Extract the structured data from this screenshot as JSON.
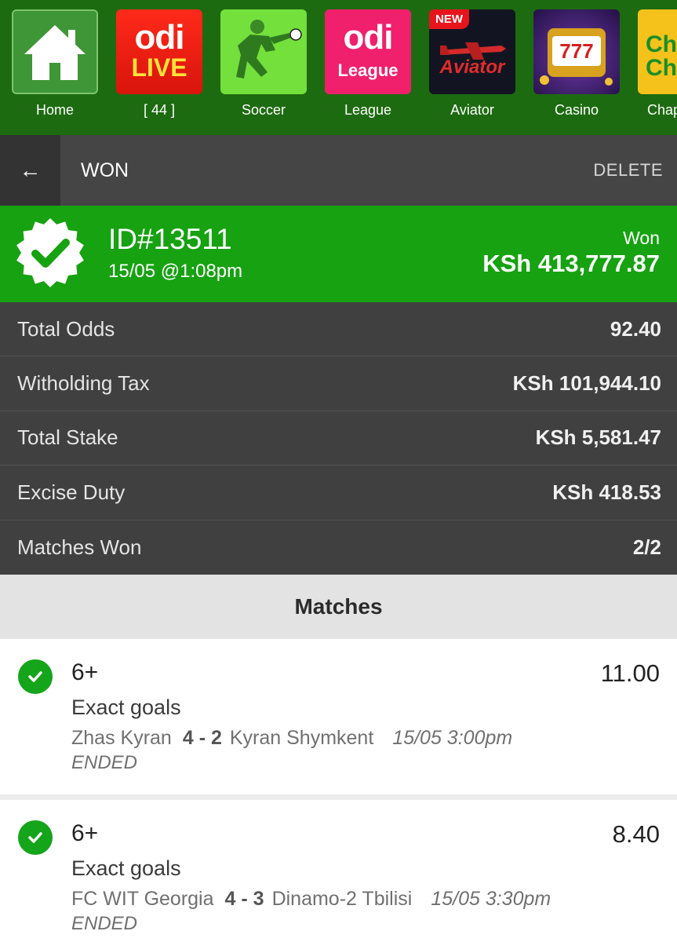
{
  "apps": [
    {
      "label": "Home"
    },
    {
      "label": "[ 44 ]",
      "logo_main": "odi",
      "logo_sub": "LIVE"
    },
    {
      "label": "Soccer"
    },
    {
      "label": "League",
      "logo_main": "odi",
      "logo_sub": "League"
    },
    {
      "label": "Aviator",
      "badge": "NEW",
      "logo_main": "Aviator"
    },
    {
      "label": "Casino",
      "logo_main": "777"
    },
    {
      "label": "Chap",
      "logo_main": "Ch\nCh"
    }
  ],
  "header": {
    "back_icon": "←",
    "title": "WON",
    "delete_label": "DELETE"
  },
  "bet": {
    "id": "ID#13511",
    "date": "15/05 @1:08pm",
    "status": "Won",
    "amount": "KSh 413,777.87",
    "colors": {
      "banner": "#16a211",
      "accent_green": "#14a51a"
    }
  },
  "summary": [
    {
      "label": "Total Odds",
      "value": "92.40"
    },
    {
      "label": "Witholding Tax",
      "value": "KSh 101,944.10"
    },
    {
      "label": "Total Stake",
      "value": "KSh 5,581.47"
    },
    {
      "label": "Excise Duty",
      "value": "KSh 418.53"
    },
    {
      "label": "Matches Won",
      "value": "2/2"
    }
  ],
  "matches_title": "Matches",
  "matches": [
    {
      "pick": "6+",
      "odds": "11.00",
      "market": "Exact goals",
      "home": "Zhas Kyran",
      "score": "4 - 2",
      "away": "Kyran Shymkent",
      "time": "15/05 3:00pm",
      "status": "ENDED"
    },
    {
      "pick": "6+",
      "odds": "8.40",
      "market": "Exact goals",
      "home": "FC WIT Georgia",
      "score": "4 - 3",
      "away": "Dinamo-2 Tbilisi",
      "time": "15/05 3:30pm",
      "status": "ENDED"
    }
  ]
}
